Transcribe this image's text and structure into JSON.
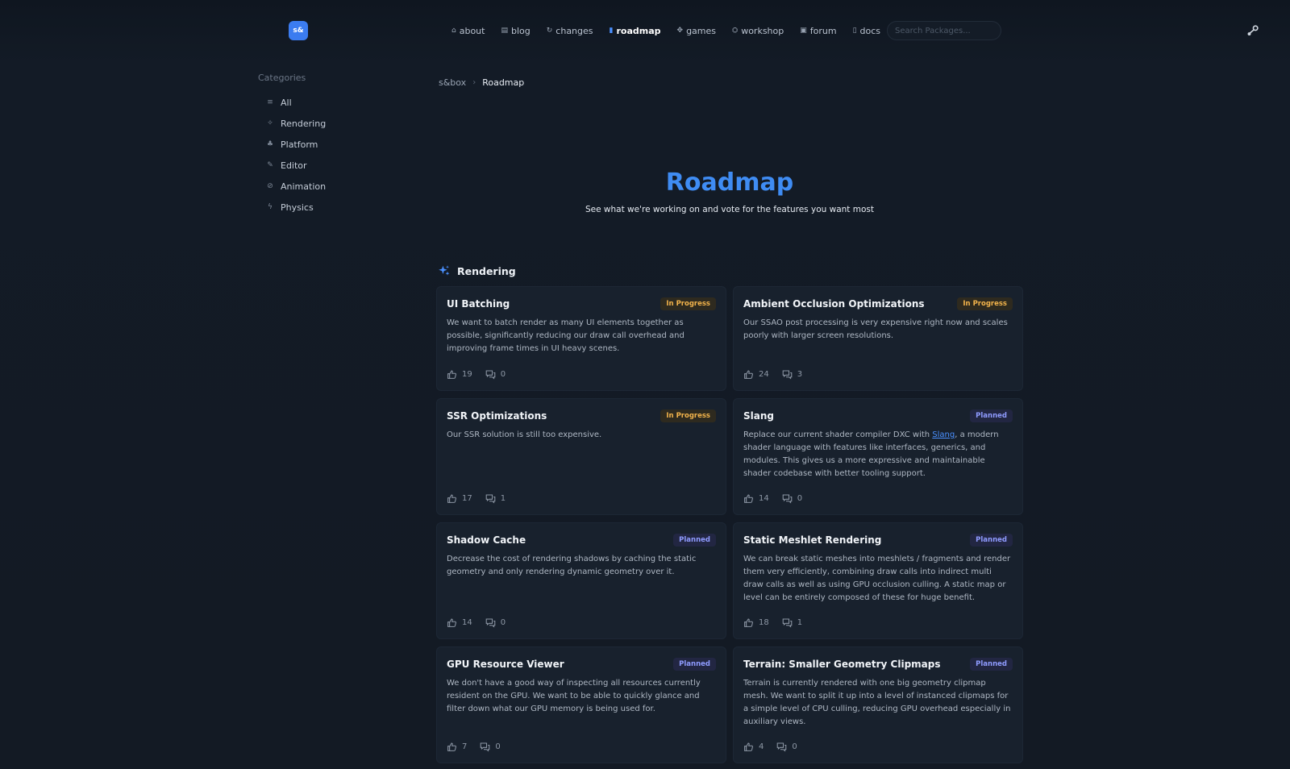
{
  "header": {
    "logo_text": "s&",
    "nav": [
      {
        "icon": "⌂",
        "label": "about",
        "active": false
      },
      {
        "icon": "▤",
        "label": "blog",
        "active": false
      },
      {
        "icon": "↻",
        "label": "changes",
        "active": false
      },
      {
        "icon": "▮",
        "label": "roadmap",
        "active": true
      },
      {
        "icon": "✥",
        "label": "games",
        "active": false
      },
      {
        "icon": "⛭",
        "label": "workshop",
        "active": false
      },
      {
        "icon": "▣",
        "label": "forum",
        "active": false
      },
      {
        "icon": "▯",
        "label": "docs",
        "active": false
      }
    ],
    "search_placeholder": "Search Packages..."
  },
  "sidebar": {
    "title": "Categories",
    "items": [
      {
        "icon": "≡",
        "label": "All"
      },
      {
        "icon": "✧",
        "label": "Rendering"
      },
      {
        "icon": "♣",
        "label": "Platform"
      },
      {
        "icon": "✎",
        "label": "Editor"
      },
      {
        "icon": "⊘",
        "label": "Animation"
      },
      {
        "icon": "ϟ",
        "label": "Physics"
      }
    ]
  },
  "breadcrumb": {
    "root": "s&box",
    "separator": "›",
    "current": "Roadmap"
  },
  "hero": {
    "title": "Roadmap",
    "subtitle": "See what we're working on and vote for the features you want most"
  },
  "section": {
    "title": "Rendering"
  },
  "cards": [
    {
      "title": "UI Batching",
      "status": "In Progress",
      "status_kind": "progress",
      "desc": "We want to batch render as many UI elements together as possible, significantly reducing our draw call overhead and improving frame times in UI heavy scenes.",
      "votes": "19",
      "comments": "0"
    },
    {
      "title": "Ambient Occlusion Optimizations",
      "status": "In Progress",
      "status_kind": "progress",
      "desc": "Our SSAO post processing is very expensive right now and scales poorly with larger screen resolutions.",
      "votes": "24",
      "comments": "3"
    },
    {
      "title": "SSR Optimizations",
      "status": "In Progress",
      "status_kind": "progress",
      "desc": "Our SSR solution is still too expensive.",
      "votes": "17",
      "comments": "1"
    },
    {
      "title": "Slang",
      "status": "Planned",
      "status_kind": "planned",
      "desc_pre": "Replace our current shader compiler DXC with ",
      "desc_link": "Slang",
      "desc_post": ", a modern shader language with features like interfaces, generics, and modules. This gives us a more expressive and maintainable shader codebase with better tooling support.",
      "votes": "14",
      "comments": "0"
    },
    {
      "title": "Shadow Cache",
      "status": "Planned",
      "status_kind": "planned",
      "desc": "Decrease the cost of rendering shadows by caching the static geometry and only rendering dynamic geometry over it.",
      "votes": "14",
      "comments": "0"
    },
    {
      "title": "Static Meshlet Rendering",
      "status": "Planned",
      "status_kind": "planned",
      "desc": "We can break static meshes into meshlets / fragments and render them very efficiently, combining draw calls into indirect multi draw calls as well as using GPU occlusion culling. A static map or level can be entirely composed of these for huge benefit.",
      "votes": "18",
      "comments": "1"
    },
    {
      "title": "GPU Resource Viewer",
      "status": "Planned",
      "status_kind": "planned",
      "desc": "We don't have a good way of inspecting all resources currently resident on the GPU. We want to be able to quickly glance and filter down what our GPU memory is being used for.",
      "votes": "7",
      "comments": "0"
    },
    {
      "title": "Terrain: Smaller Geometry Clipmaps",
      "status": "Planned",
      "status_kind": "planned",
      "desc": "Terrain is currently rendered with one big geometry clipmap mesh. We want to split it up into a level of instanced clipmaps for a simple level of CPU culling, reducing GPU overhead especially in auxiliary views.",
      "votes": "4",
      "comments": "0"
    }
  ],
  "colors": {
    "accent": "#3f8cf3",
    "in_progress": "#f2b34b",
    "planned": "#8f9bff",
    "background": "#131a24"
  }
}
